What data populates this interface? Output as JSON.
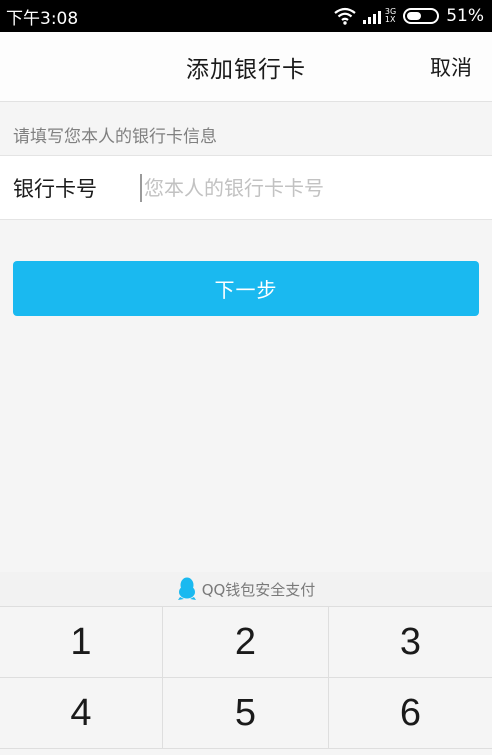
{
  "status_bar": {
    "time": "下午3:08",
    "network_type": "3G",
    "network_sub": "1X",
    "battery_text": "51%",
    "battery_level": 0.51
  },
  "header": {
    "title": "添加银行卡",
    "cancel_label": "取消"
  },
  "form": {
    "hint": "请填写您本人的银行卡信息",
    "card_label": "银行卡号",
    "card_value": "",
    "card_placeholder": "您本人的银行卡卡号"
  },
  "next_button_label": "下一步",
  "security": {
    "text": "QQ钱包安全支付",
    "icon": "qq-penguin-icon",
    "icon_color": "#1ab9f0"
  },
  "keypad": {
    "keys": [
      "1",
      "2",
      "3",
      "4",
      "5",
      "6"
    ]
  },
  "colors": {
    "accent": "#1ab9f0",
    "status_bar": "#000000",
    "background": "#f5f5f5"
  }
}
